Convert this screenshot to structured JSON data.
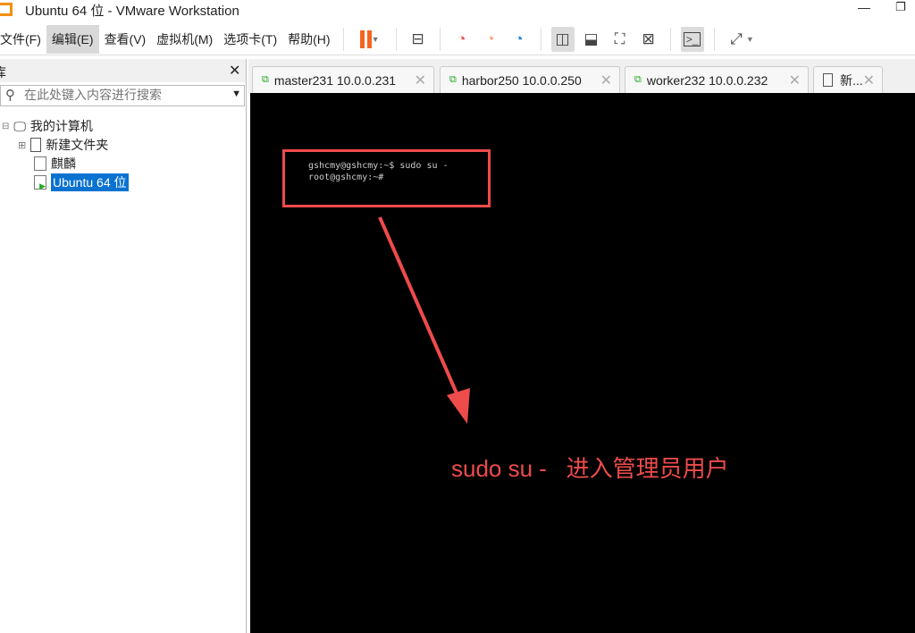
{
  "window": {
    "title": "Ubuntu 64 位 - VMware Workstation"
  },
  "menu": [
    "文件(F)",
    "编辑(E)",
    "查看(V)",
    "虚拟机(M)",
    "选项卡(T)",
    "帮助(H)"
  ],
  "sidebar": {
    "header": "库",
    "search_placeholder": "在此处键入内容进行搜索",
    "tree": [
      {
        "label": "我的计算机"
      },
      {
        "label": "新建文件夹"
      },
      {
        "label": "麒麟"
      },
      {
        "label": "Ubuntu 64 位"
      }
    ]
  },
  "tabs": [
    {
      "label": "master231 10.0.0.231"
    },
    {
      "label": "harbor250 10.0.0.250"
    },
    {
      "label": "worker232 10.0.0.232"
    },
    {
      "label": "新..."
    }
  ],
  "terminal": {
    "line1": "gshcmy@gshcmy:~$ sudo su -",
    "line2": "root@gshcmy:~#"
  },
  "annotation": {
    "text": "sudo su -   进入管理员用户",
    "color": "#ee4b4b"
  },
  "colors": {
    "pause": "#f26522",
    "selection": "#0a72d0"
  }
}
